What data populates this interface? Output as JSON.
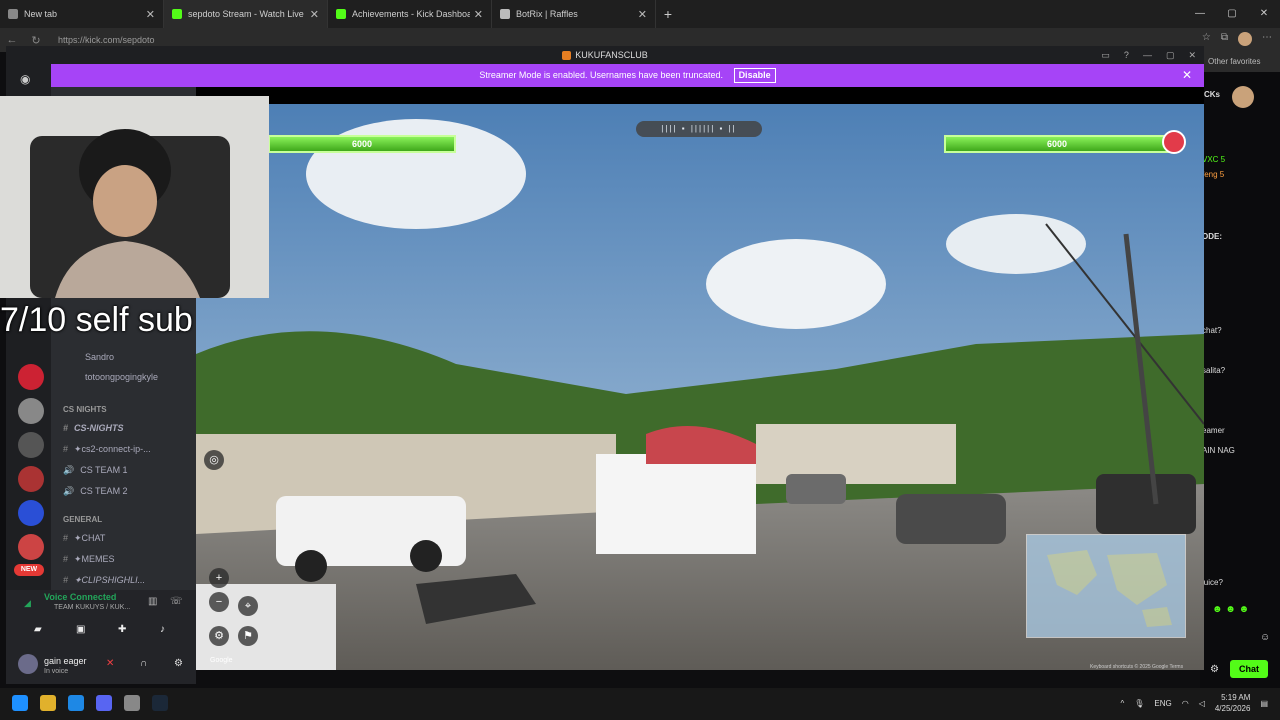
{
  "browser": {
    "tabs": [
      {
        "title": "New tab",
        "active": false,
        "favicon_color": "#888888"
      },
      {
        "title": "sepdoto Stream - Watch Live",
        "active": true,
        "favicon_color": "#53fc18"
      },
      {
        "title": "Achievements - Kick Dashboard",
        "active": false,
        "favicon_color": "#53fc18"
      },
      {
        "title": "BotRix | Raffles",
        "active": false,
        "favicon_color": "#bbbbbb"
      }
    ],
    "new_tab_label": "+",
    "url": "https://kick.com/sepdoto",
    "favorites_bar": "Other favorites"
  },
  "discord": {
    "window_title": "KUKUFANSCLUB",
    "banner_text": "Streamer Mode is enabled. Usernames have been truncated.",
    "banner_button": "Disable",
    "new_badge": "NEW",
    "channels": {
      "users": [
        "Sandro",
        "totoongpogingkyle"
      ],
      "categories": [
        {
          "name": "CS NIGHTS",
          "items": [
            "CS-NIGHTS",
            "✦cs2-connect-ip-...",
            "CS TEAM 1",
            "CS TEAM 2"
          ]
        },
        {
          "name": "GENERAL",
          "items": [
            "✦CHAT",
            "✦MEMES",
            "✦CLIPSHIGHLI..."
          ]
        }
      ]
    },
    "voice": {
      "status": "Voice Connected",
      "channel": "TEAM KUKUYS / KUK..."
    },
    "user": {
      "name": "gain eager",
      "status": "In voice"
    }
  },
  "stream": {
    "overlay_text": "7/10 self sub",
    "left_health": "6000",
    "right_health": "6000",
    "attribution": "Keyboard shortcuts  © 2025 Google  Terms",
    "google_logo": "Google"
  },
  "kick": {
    "chat_lines": [
      "VXC 5",
      "feng 5",
      "ODE:",
      "chat?",
      "salita?",
      "eamer",
      "AIN NAG",
      "juice?"
    ],
    "chat_button": "Chat",
    "header_text": "CKs"
  },
  "taskbar": {
    "lang": "ENG",
    "time": "5:19 AM",
    "date": "4/25/2026"
  },
  "colors": {
    "kick_green": "#53fc18",
    "discord_purple": "#a644f7"
  }
}
